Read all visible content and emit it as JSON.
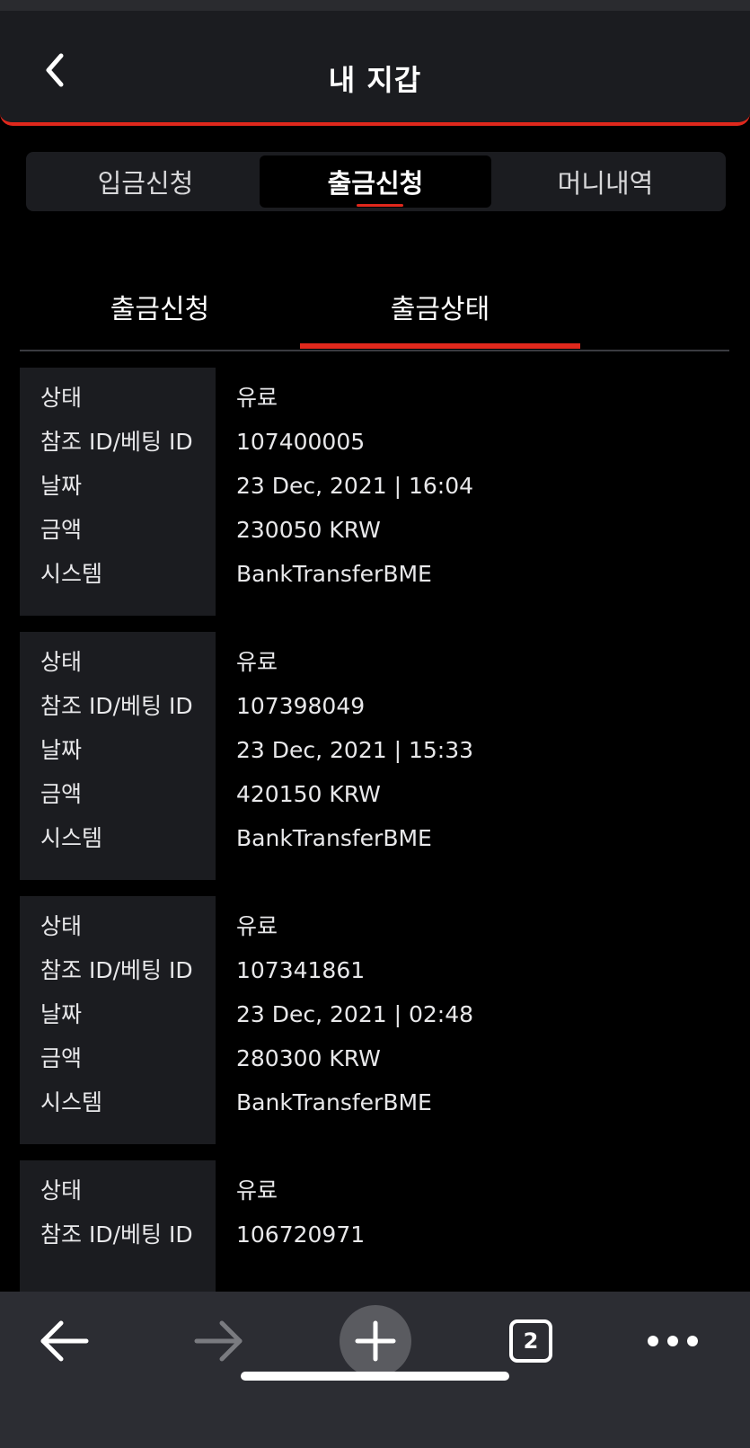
{
  "header": {
    "title": "내 지갑"
  },
  "segments": [
    {
      "label": "입금신청"
    },
    {
      "label": "출금신청"
    },
    {
      "label": "머니내역"
    }
  ],
  "subtabs": [
    {
      "label": "출금신청"
    },
    {
      "label": "출금상태"
    }
  ],
  "active_segment": "출금신청",
  "active_subtab": "출금상태",
  "field_labels": {
    "status": "상태",
    "ref_id": "참조 ID/베팅 ID",
    "date": "날짜",
    "amount": "금액",
    "system": "시스템"
  },
  "transactions": [
    {
      "status": "유료",
      "ref_id": "107400005",
      "date": "23 Dec, 2021 | 16:04",
      "amount": "230050 KRW",
      "system": "BankTransferBME"
    },
    {
      "status": "유료",
      "ref_id": "107398049",
      "date": "23 Dec, 2021 | 15:33",
      "amount": "420150 KRW",
      "system": "BankTransferBME"
    },
    {
      "status": "유료",
      "ref_id": "107341861",
      "date": "23 Dec, 2021 | 02:48",
      "amount": "280300 KRW",
      "system": "BankTransferBME"
    },
    {
      "status": "유료",
      "ref_id": "106720971"
    }
  ],
  "browser": {
    "tab_count": "2"
  },
  "colors": {
    "accent": "#e0281c",
    "panel": "#1b1c20",
    "background": "#000000",
    "toolbar": "#2c2d33"
  },
  "icons": [
    "back-chevron-icon",
    "arrow-left-icon",
    "arrow-right-icon",
    "plus-icon",
    "tabs-icon",
    "more-icon"
  ]
}
